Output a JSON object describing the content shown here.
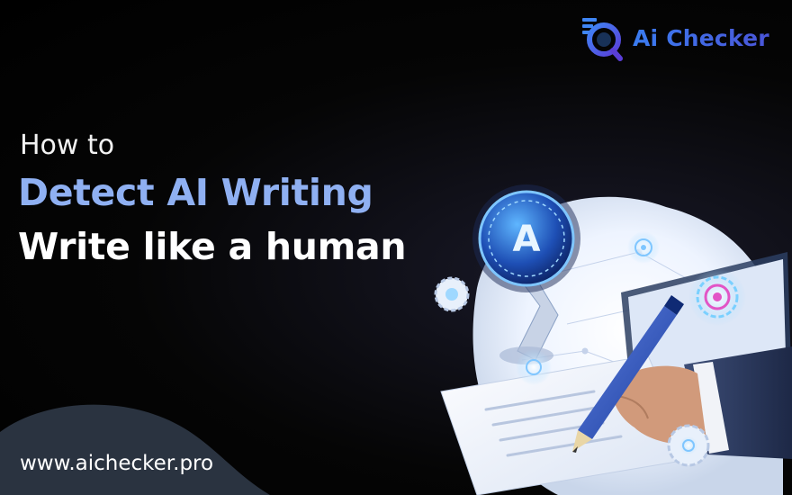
{
  "logo": {
    "text": "Ai Checker",
    "icon": "document-magnifier-icon",
    "colors": {
      "primary": "#2f6de6",
      "secondary": "#5b3fd6"
    }
  },
  "headline": {
    "eyebrow": "How to",
    "line_blue": "Detect AI Writing",
    "line_white": "Write like a human"
  },
  "footer": {
    "url": "www.aichecker.pro"
  },
  "illustration": {
    "badge_letter": "A",
    "icons": [
      "ai-letter-badge-icon",
      "pen-icon",
      "hand-icon",
      "document-icon",
      "smiley-target-icon",
      "gear-icon"
    ]
  },
  "colors": {
    "background": "#000000",
    "headline_blue": "#8fb0f2",
    "wave": "#2a3340",
    "glow": "#9fd8ff"
  }
}
